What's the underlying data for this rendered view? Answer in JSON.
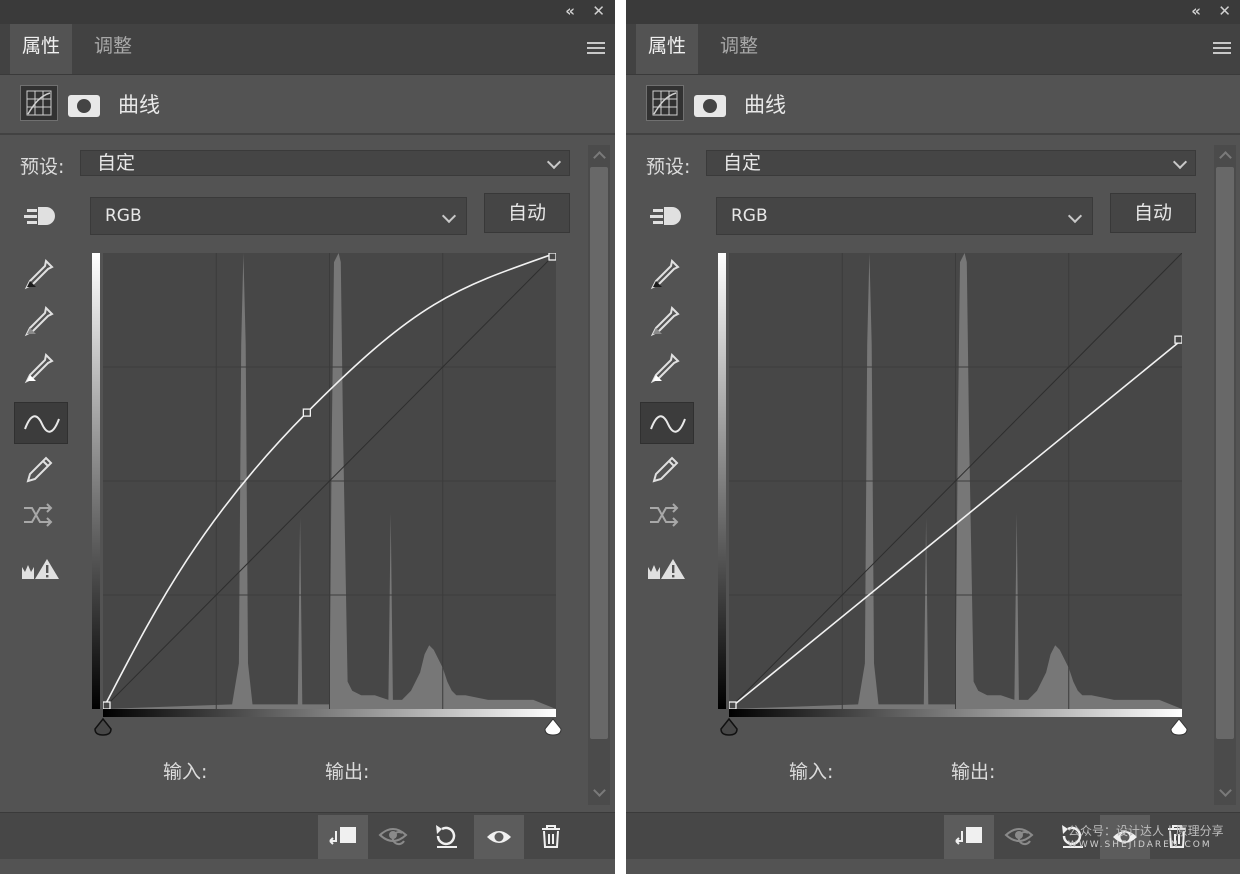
{
  "panels": [
    {
      "tabs": {
        "active": "属性",
        "inactive": "调整"
      },
      "title": "曲线",
      "preset_label": "预设:",
      "preset_value": "自定",
      "channel": "RGB",
      "auto_label": "自动",
      "input_label": "输入:",
      "output_label": "输出:",
      "curve_points": [
        [
          0,
          0
        ],
        [
          45,
          65
        ],
        [
          100,
          100
        ]
      ]
    },
    {
      "tabs": {
        "active": "属性",
        "inactive": "调整"
      },
      "title": "曲线",
      "preset_label": "预设:",
      "preset_value": "自定",
      "channel": "RGB",
      "auto_label": "自动",
      "input_label": "输入:",
      "output_label": "输出:",
      "curve_points": [
        [
          0,
          0
        ],
        [
          100,
          81
        ]
      ]
    }
  ],
  "histogram": [
    [
      0,
      0
    ],
    [
      28.5,
      1
    ],
    [
      30,
      10
    ],
    [
      30.5,
      80
    ],
    [
      31,
      100
    ],
    [
      31.5,
      80
    ],
    [
      32,
      10
    ],
    [
      33,
      1
    ],
    [
      43,
      1
    ],
    [
      43.5,
      42
    ],
    [
      44,
      1
    ],
    [
      50,
      1
    ],
    [
      50.5,
      60
    ],
    [
      51,
      98
    ],
    [
      52,
      100
    ],
    [
      52.5,
      98
    ],
    [
      53,
      60
    ],
    [
      54,
      6
    ],
    [
      55,
      4
    ],
    [
      57,
      3
    ],
    [
      60,
      3
    ],
    [
      63,
      2
    ],
    [
      63.5,
      43
    ],
    [
      64,
      2
    ],
    [
      66,
      2
    ],
    [
      68,
      4
    ],
    [
      70,
      8
    ],
    [
      71,
      12
    ],
    [
      72,
      14
    ],
    [
      73,
      13
    ],
    [
      74,
      11
    ],
    [
      75,
      9
    ],
    [
      76,
      6
    ],
    [
      77,
      4
    ],
    [
      78,
      3
    ],
    [
      80,
      3
    ],
    [
      85,
      2
    ],
    [
      90,
      2
    ],
    [
      95,
      2
    ],
    [
      100,
      0
    ]
  ],
  "icons": [
    "collapse-icon",
    "close-icon",
    "panel-menu-icon",
    "curves-adjustment-icon",
    "layer-mask-icon",
    "chevron-down-icon",
    "on-image-adjust-icon",
    "black-point-eyedropper-icon",
    "gray-point-eyedropper-icon",
    "white-point-eyedropper-icon",
    "curve-edit-icon",
    "pencil-icon",
    "smooth-icon",
    "clipping-warning-icon",
    "clip-to-layer-icon",
    "view-previous-icon",
    "reset-icon",
    "visibility-eye-icon",
    "trash-icon"
  ],
  "watermark": {
    "text": "公众号：设计达人 | 原理分享",
    "url": "WWW.SHEJIDAREN.COM"
  }
}
